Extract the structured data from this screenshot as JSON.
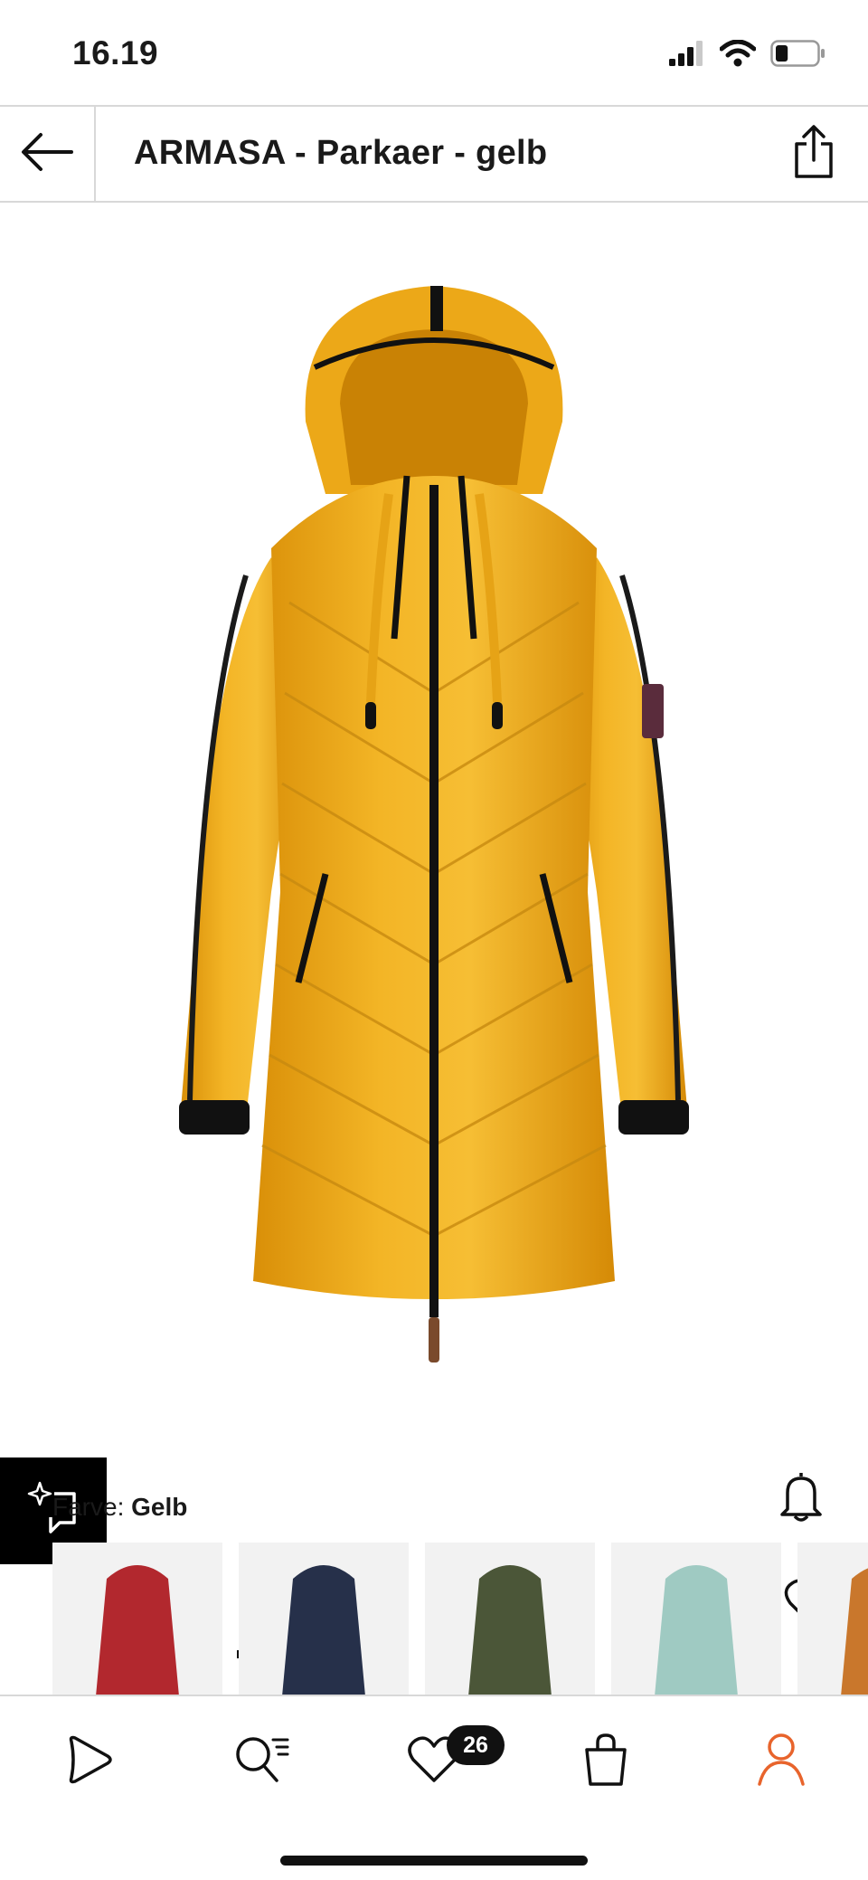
{
  "status_bar": {
    "time": "16.19",
    "icons": [
      "signal-icon",
      "wifi-icon",
      "battery-icon"
    ],
    "battery_level": 0.3
  },
  "header": {
    "title": "ARMASA - Parkaer - gelb",
    "back_icon": "arrow-left-icon",
    "share_icon": "share-icon"
  },
  "product": {
    "image_icon": "coat-image",
    "main_color": "#F2B01E",
    "compare_icon": "sparkle-compare-icon",
    "notify_icon": "bell-icon",
    "wishlist_icon": "heart-icon",
    "gallery": {
      "active_index": 0
    }
  },
  "color_selector": {
    "label": "Farve:",
    "selected": "Gelb",
    "swatches": [
      {
        "color": "#B2282E"
      },
      {
        "color": "#26304A"
      },
      {
        "color": "#4B5638"
      },
      {
        "color": "#9FCAC2"
      },
      {
        "color": "#C9772C"
      }
    ]
  },
  "bottom_nav": {
    "items": [
      "play-icon",
      "search-list-icon",
      "heart-icon",
      "bag-icon",
      "user-icon"
    ],
    "wishlist_count": "26",
    "active": "user-icon",
    "accent_color": "#E8642C"
  }
}
